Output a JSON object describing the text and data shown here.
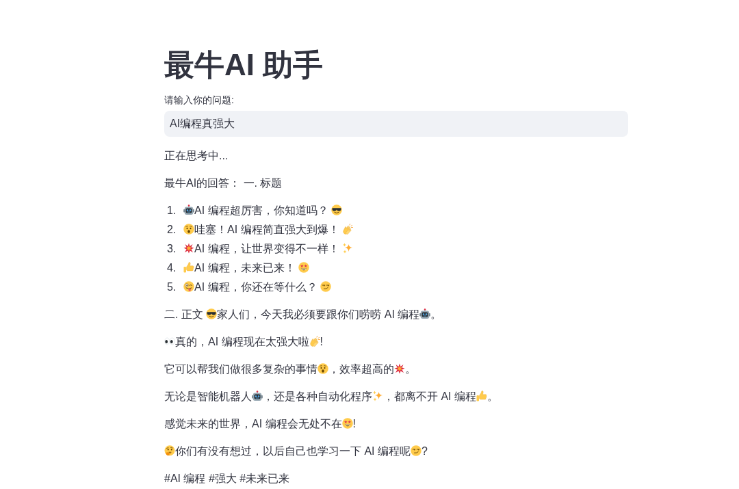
{
  "title": "最牛AI 助手",
  "question_input": {
    "label": "请输入你的问题:",
    "value": "AI编程真强大"
  },
  "status": "正在思考中...",
  "answer": {
    "heading": "最牛AI的回答： 一. 标题",
    "list": [
      {
        "number": "1.",
        "segments": [
          {
            "kind": "robot"
          },
          {
            "kind": "text",
            "text": "AI 编程超厉害，你知道吗？ "
          },
          {
            "kind": "sunglasses"
          }
        ]
      },
      {
        "number": "2.",
        "segments": [
          {
            "kind": "surprised"
          },
          {
            "kind": "text",
            "text": "哇塞！AI 编程简直强大到爆！ "
          },
          {
            "kind": "clap"
          }
        ]
      },
      {
        "number": "3.",
        "segments": [
          {
            "kind": "collision"
          },
          {
            "kind": "text",
            "text": "AI 编程，让世界变得不一样！ "
          },
          {
            "kind": "sparkles"
          }
        ]
      },
      {
        "number": "4.",
        "segments": [
          {
            "kind": "thumbsup"
          },
          {
            "kind": "text",
            "text": "AI 编程，未来已来！ "
          },
          {
            "kind": "starstruck"
          }
        ]
      },
      {
        "number": "5.",
        "segments": [
          {
            "kind": "zany"
          },
          {
            "kind": "text",
            "text": "AI 编程，你还在等什么？ "
          },
          {
            "kind": "smirk"
          }
        ]
      }
    ],
    "paragraphs": [
      [
        {
          "kind": "text",
          "text": "二. 正文 "
        },
        {
          "kind": "sunglasses"
        },
        {
          "kind": "text",
          "text": "家人们，今天我必须要跟你们唠唠 AI 编程"
        },
        {
          "kind": "robot"
        },
        {
          "kind": "text",
          "text": "。"
        }
      ],
      [
        {
          "kind": "eyes"
        },
        {
          "kind": "text",
          "text": "真的，AI 编程现在太强大啦"
        },
        {
          "kind": "clap"
        },
        {
          "kind": "text",
          "text": "!"
        }
      ],
      [
        {
          "kind": "text",
          "text": "它可以帮我们做很多复杂的事情"
        },
        {
          "kind": "surprised"
        },
        {
          "kind": "text",
          "text": "，效率超高的"
        },
        {
          "kind": "collision"
        },
        {
          "kind": "text",
          "text": "。"
        }
      ],
      [
        {
          "kind": "text",
          "text": "无论是智能机器人"
        },
        {
          "kind": "robot"
        },
        {
          "kind": "text",
          "text": "，还是各种自动化程序"
        },
        {
          "kind": "sparkles"
        },
        {
          "kind": "text",
          "text": "，都离不开 AI 编程"
        },
        {
          "kind": "thumbsup"
        },
        {
          "kind": "text",
          "text": "。"
        }
      ],
      [
        {
          "kind": "text",
          "text": "感觉未来的世界，AI 编程会无处不在"
        },
        {
          "kind": "starstruck"
        },
        {
          "kind": "text",
          "text": "!"
        }
      ],
      [
        {
          "kind": "thinking"
        },
        {
          "kind": "text",
          "text": "你们有没有想过，以后自己也学习一下 AI 编程呢"
        },
        {
          "kind": "smirk"
        },
        {
          "kind": "text",
          "text": "?"
        }
      ]
    ],
    "hashtags": "#AI 编程 #强大 #未来已来"
  }
}
